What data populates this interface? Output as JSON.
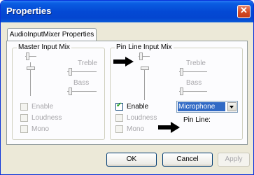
{
  "window": {
    "title": "Properties"
  },
  "tabs": [
    {
      "label": "AudioInputMixer Properties"
    }
  ],
  "master_group": {
    "title": "Master Input Mix",
    "treble_label": "Treble",
    "bass_label": "Bass",
    "checkboxes": [
      {
        "label": "Enable",
        "checked": false
      },
      {
        "label": "Loudness",
        "checked": false
      },
      {
        "label": "Mono",
        "checked": false
      }
    ]
  },
  "pin_group": {
    "title": "Pin Line Input Mix",
    "treble_label": "Treble",
    "bass_label": "Bass",
    "checkboxes": [
      {
        "label": "Enable",
        "checked": true
      },
      {
        "label": "Loudness",
        "checked": false
      },
      {
        "label": "Mono",
        "checked": false
      }
    ],
    "pin_line_label": "Pin Line:",
    "pin_line_value": "Microphone"
  },
  "buttons": {
    "ok": "OK",
    "cancel": "Cancel",
    "apply": "Apply"
  },
  "colors": {
    "title_bar": "#0449d4",
    "selection": "#316ac5",
    "arrow": "#000000"
  }
}
